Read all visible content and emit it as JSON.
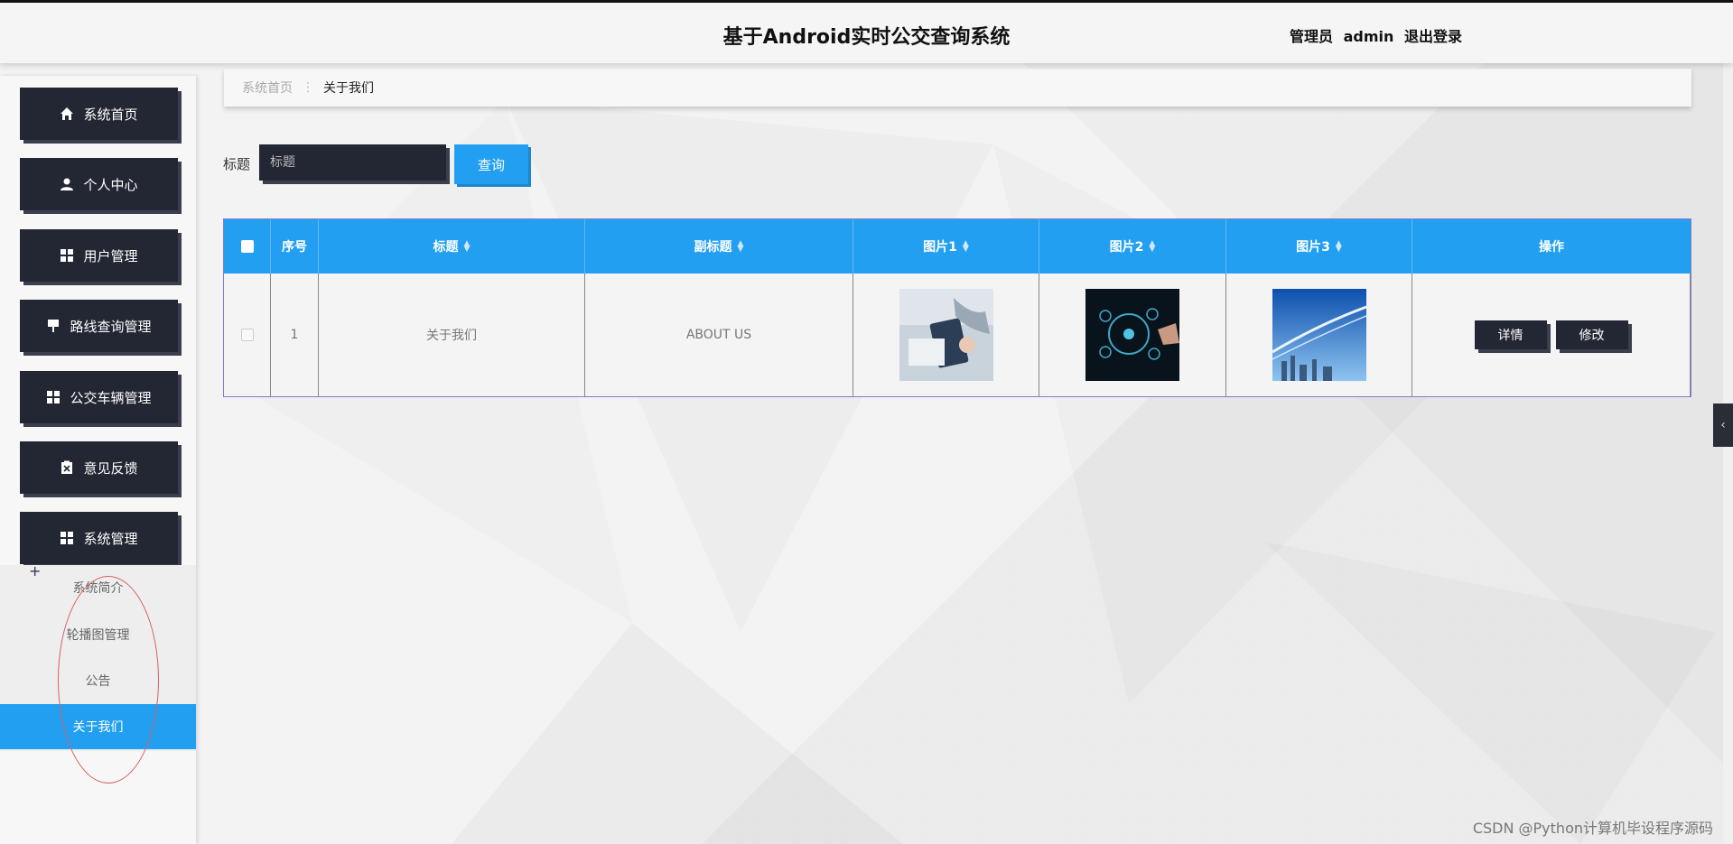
{
  "header": {
    "title": "基于Android实时公交查询系统",
    "admin_role": "管理员",
    "admin_name": "admin",
    "logout_label": "退出登录"
  },
  "sidebar": {
    "items": [
      {
        "label": "系统首页",
        "icon": "home-icon"
      },
      {
        "label": "个人中心",
        "icon": "user-icon"
      },
      {
        "label": "用户管理",
        "icon": "grid-icon"
      },
      {
        "label": "路线查询管理",
        "icon": "flag-icon"
      },
      {
        "label": "公交车辆管理",
        "icon": "grid-icon"
      },
      {
        "label": "意见反馈",
        "icon": "clipboard-icon"
      },
      {
        "label": "系统管理",
        "icon": "grid-icon"
      }
    ],
    "submenu": [
      {
        "label": "系统简介"
      },
      {
        "label": "轮播图管理"
      },
      {
        "label": "公告"
      },
      {
        "label": "关于我们",
        "active": true
      }
    ]
  },
  "breadcrumb": {
    "home": "系统首页",
    "current": "关于我们"
  },
  "search": {
    "label": "标题",
    "placeholder": "标题",
    "button": "查询"
  },
  "table": {
    "headers": [
      "序号",
      "标题",
      "副标题",
      "图片1",
      "图片2",
      "图片3",
      "操作"
    ],
    "rows": [
      {
        "index": "1",
        "title": "关于我们",
        "subtitle": "ABOUT US",
        "actions": [
          "详情",
          "修改"
        ]
      }
    ]
  },
  "colors": {
    "accent": "#239ff2",
    "dark": "#232633"
  },
  "watermark": "CSDN @Python计算机毕设程序源码"
}
